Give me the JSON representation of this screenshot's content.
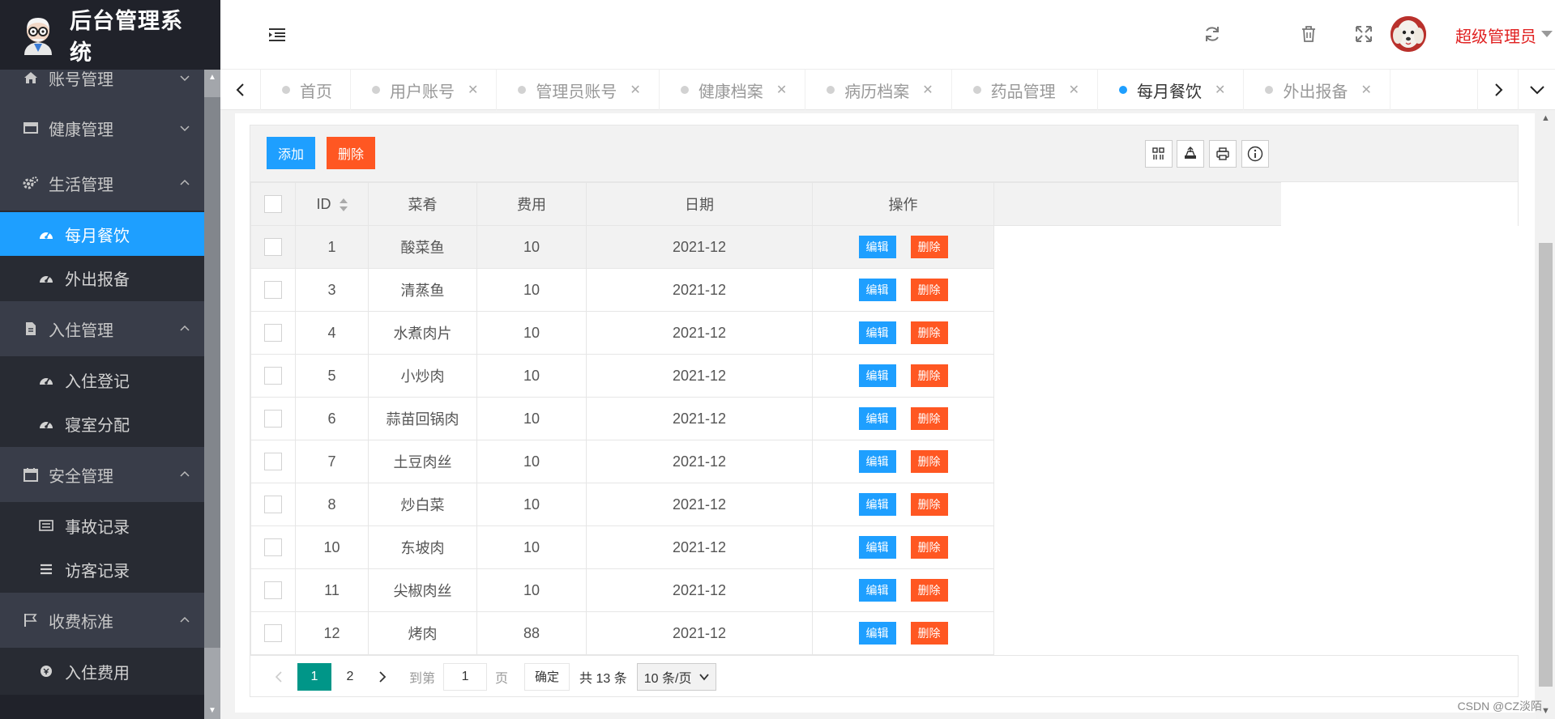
{
  "app": {
    "title": "后台管理系统"
  },
  "sidebar": {
    "items": [
      {
        "label": "账号管理",
        "icon": "home-icon"
      },
      {
        "label": "健康管理",
        "icon": "window-icon"
      },
      {
        "label": "生活管理",
        "icon": "gears-icon"
      },
      {
        "label": "每月餐饮",
        "icon": "dashboard-icon"
      },
      {
        "label": "外出报备",
        "icon": "dashboard-icon"
      },
      {
        "label": "入住管理",
        "icon": "file-icon"
      },
      {
        "label": "入住登记",
        "icon": "dashboard-icon"
      },
      {
        "label": "寝室分配",
        "icon": "dashboard-icon"
      },
      {
        "label": "安全管理",
        "icon": "calendar-icon"
      },
      {
        "label": "事故记录",
        "icon": "list-alt-icon"
      },
      {
        "label": "访客记录",
        "icon": "bars-icon"
      },
      {
        "label": "收费标准",
        "icon": "flag-icon"
      },
      {
        "label": "入住费用",
        "icon": "coin-icon"
      }
    ]
  },
  "header": {
    "user_name": "超级管理员",
    "icons": [
      "refresh-icon",
      "trash-icon",
      "fullscreen-icon"
    ]
  },
  "tabs": [
    {
      "label": "首页",
      "closable": false,
      "active": false
    },
    {
      "label": "用户账号",
      "closable": true,
      "active": false
    },
    {
      "label": "管理员账号",
      "closable": true,
      "active": false
    },
    {
      "label": "健康档案",
      "closable": true,
      "active": false
    },
    {
      "label": "病历档案",
      "closable": true,
      "active": false
    },
    {
      "label": "药品管理",
      "closable": true,
      "active": false
    },
    {
      "label": "每月餐饮",
      "closable": true,
      "active": true
    },
    {
      "label": "外出报备",
      "closable": true,
      "active": false
    }
  ],
  "toolbar": {
    "add_label": "添加",
    "delete_label": "删除"
  },
  "table": {
    "headers": {
      "id": "ID",
      "dish": "菜肴",
      "cost": "费用",
      "date": "日期",
      "actions": "操作"
    },
    "edit_label": "编辑",
    "delete_label": "删除",
    "rows": [
      {
        "id": "1",
        "dish": "酸菜鱼",
        "cost": "10",
        "date": "2021-12"
      },
      {
        "id": "3",
        "dish": "清蒸鱼",
        "cost": "10",
        "date": "2021-12"
      },
      {
        "id": "4",
        "dish": "水煮肉片",
        "cost": "10",
        "date": "2021-12"
      },
      {
        "id": "5",
        "dish": "小炒肉",
        "cost": "10",
        "date": "2021-12"
      },
      {
        "id": "6",
        "dish": "蒜苗回锅肉",
        "cost": "10",
        "date": "2021-12"
      },
      {
        "id": "7",
        "dish": "土豆肉丝",
        "cost": "10",
        "date": "2021-12"
      },
      {
        "id": "8",
        "dish": "炒白菜",
        "cost": "10",
        "date": "2021-12"
      },
      {
        "id": "10",
        "dish": "东坡肉",
        "cost": "10",
        "date": "2021-12"
      },
      {
        "id": "11",
        "dish": "尖椒肉丝",
        "cost": "10",
        "date": "2021-12"
      },
      {
        "id": "12",
        "dish": "烤肉",
        "cost": "88",
        "date": "2021-12"
      }
    ]
  },
  "pagination": {
    "current_page": "1",
    "next_page": "2",
    "goto_label": "到第",
    "page_input": "1",
    "page_unit": "页",
    "confirm_label": "确定",
    "total_text": "共 13 条",
    "page_size": "10 条/页"
  },
  "watermark": "CSDN @CZ淡陌",
  "colors": {
    "accent": "#1e9fff",
    "danger": "#ff5722",
    "page_active": "#009688",
    "sidebar_bg": "#20222a",
    "user_name": "#e02020"
  }
}
